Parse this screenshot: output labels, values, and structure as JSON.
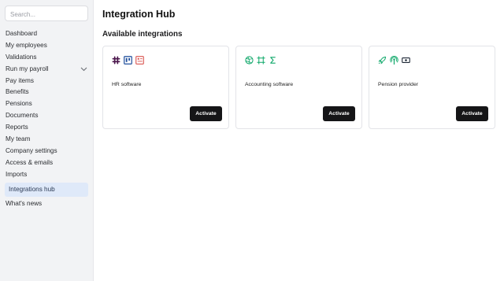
{
  "search": {
    "placeholder": "Search..."
  },
  "sidebar": {
    "items": [
      {
        "label": "Dashboard"
      },
      {
        "label": "My employees"
      },
      {
        "label": "Validations"
      },
      {
        "label": "Run my payroll"
      },
      {
        "label": "Pay items"
      },
      {
        "label": "Benefits"
      },
      {
        "label": "Pensions"
      },
      {
        "label": "Documents"
      },
      {
        "label": "Reports"
      },
      {
        "label": "My team"
      },
      {
        "label": "Company settings"
      },
      {
        "label": "Access & emails"
      },
      {
        "label": "Imports"
      },
      {
        "label": "Integrations hub"
      },
      {
        "label": "What's news"
      }
    ],
    "active_item": "Integrations hub",
    "expandable_item": "Run my payroll"
  },
  "main": {
    "title": "Integration Hub",
    "section_title": "Available integrations",
    "cards": [
      {
        "name": "HR software",
        "button_label": "Activate",
        "icons": [
          "slack-icon",
          "trello-icon",
          "form-icon"
        ]
      },
      {
        "name": "Accounting software",
        "button_label": "Activate",
        "icons": [
          "globe-icon",
          "crop-icon",
          "sigma-icon"
        ]
      },
      {
        "name": "Pension provider",
        "button_label": "Activate",
        "icons": [
          "rocket-icon",
          "podcast-icon",
          "cash-icon"
        ]
      }
    ]
  },
  "colors": {
    "sidebar_bg": "#f2f3f5",
    "active_bg": "#dfe9f9",
    "button_bg": "#151517",
    "hr_icon_purple": "#4a154b",
    "hr_icon_blue": "#1f4e9c",
    "hr_icon_red": "#d9534f",
    "green_icon": "#0fa86a",
    "dark_icon": "#1f2937"
  }
}
